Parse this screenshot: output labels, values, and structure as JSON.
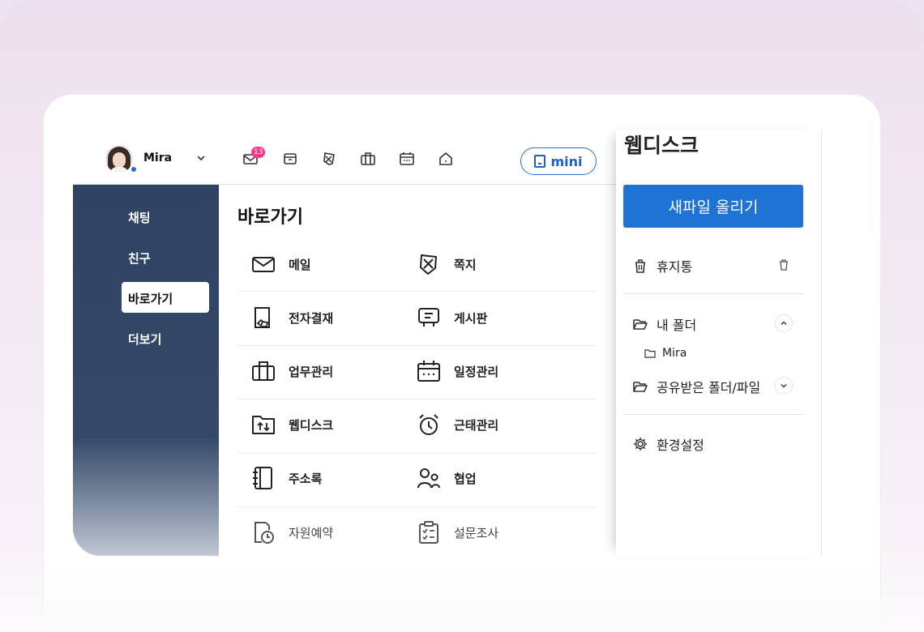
{
  "header": {
    "user_name": "Mira",
    "mail_badge": "13",
    "mini_label": "mini",
    "icons": [
      "mail-icon",
      "archive-icon",
      "note-icon",
      "briefcase-icon",
      "calendar-icon",
      "home-icon"
    ]
  },
  "sidebar": {
    "items": [
      {
        "label": "채팅"
      },
      {
        "label": "친구"
      },
      {
        "label": "바로가기"
      },
      {
        "label": "더보기"
      }
    ],
    "active": "바로가기"
  },
  "shortcuts": {
    "title": "바로가기",
    "items": [
      {
        "label": "메일",
        "icon": "mail-icon"
      },
      {
        "label": "쪽지",
        "icon": "note-icon"
      },
      {
        "label": "전자결재",
        "icon": "approval-icon"
      },
      {
        "label": "게시판",
        "icon": "board-icon"
      },
      {
        "label": "업무관리",
        "icon": "briefcase-icon"
      },
      {
        "label": "일정관리",
        "icon": "calendar-icon"
      },
      {
        "label": "웹디스크",
        "icon": "webdisk-icon"
      },
      {
        "label": "근태관리",
        "icon": "alarm-icon"
      },
      {
        "label": "주소록",
        "icon": "addressbook-icon"
      },
      {
        "label": "협업",
        "icon": "people-icon"
      },
      {
        "label": "자원예약",
        "icon": "reservation-icon"
      },
      {
        "label": "설문조사",
        "icon": "survey-icon"
      }
    ]
  },
  "webdisk": {
    "title": "웹디스크",
    "upload_label": "새파일 올리기",
    "trash_label": "휴지통",
    "my_folder_label": "내 폴더",
    "sub_folder_label": "Mira",
    "shared_label": "공유받은 폴더/파일",
    "settings_label": "환경설정"
  },
  "colors": {
    "sidebar_bg": "#2f4364",
    "accent": "#1e73d4",
    "badge": "#f13c8c"
  }
}
